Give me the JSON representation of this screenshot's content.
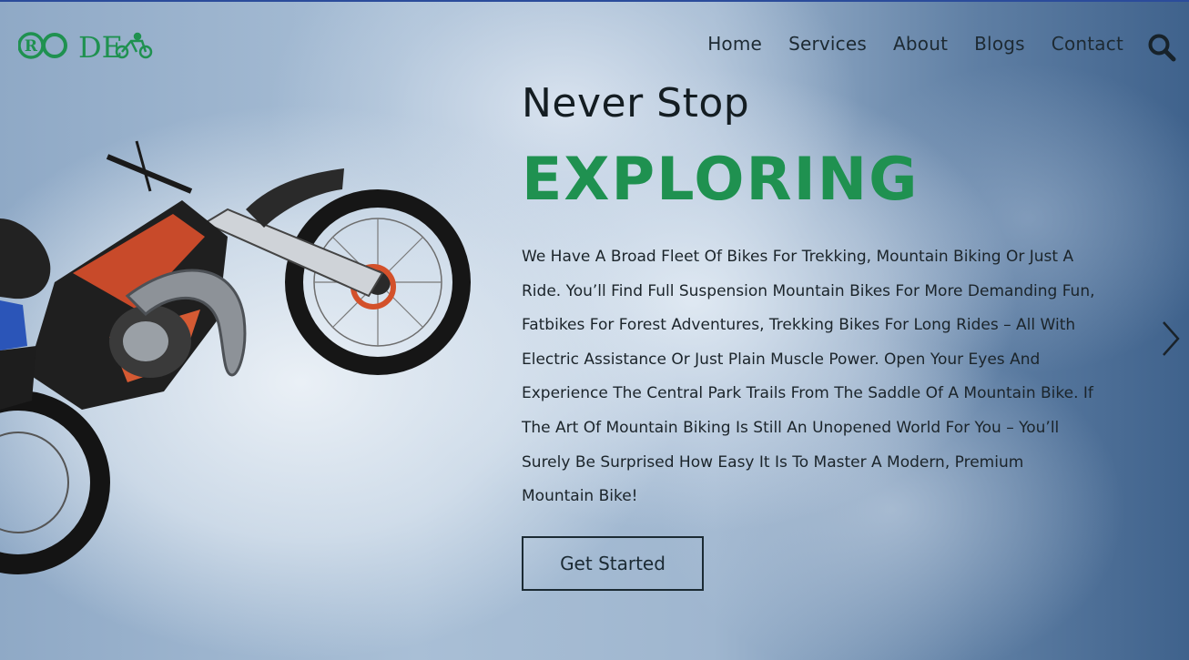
{
  "logo": {
    "text": "RODE",
    "icon": "bicycle-icon"
  },
  "nav": {
    "items": [
      {
        "label": "Home"
      },
      {
        "label": "Services"
      },
      {
        "label": "About"
      },
      {
        "label": "Blogs"
      },
      {
        "label": "Contact"
      }
    ],
    "search_icon": "search-icon"
  },
  "hero": {
    "kicker": "Never Stop",
    "headline": "EXPLORING",
    "description": "We Have A Broad Fleet Of Bikes For Trekking, Mountain Biking Or Just A Ride. You’ll Find Full Suspension Mountain Bikes For More Demanding Fun, Fatbikes For Forest Adventures, Trekking Bikes For Long Rides – All With Electric Assistance Or Just Plain Muscle Power. Open Your Eyes And Experience The Central Park Trails From The Saddle Of A Mountain Bike. If The Art Of Mountain Biking Is Still An Unopened World For You – You’ll Surely Be Surprised How Easy It Is To Master A Modern, Premium Mountain Bike!",
    "cta_label": "Get Started",
    "next_icon": "chevron-right-icon"
  },
  "colors": {
    "brand_green": "#1f9150",
    "text_dark": "#1b242a",
    "sky": "#6b8fb3"
  }
}
